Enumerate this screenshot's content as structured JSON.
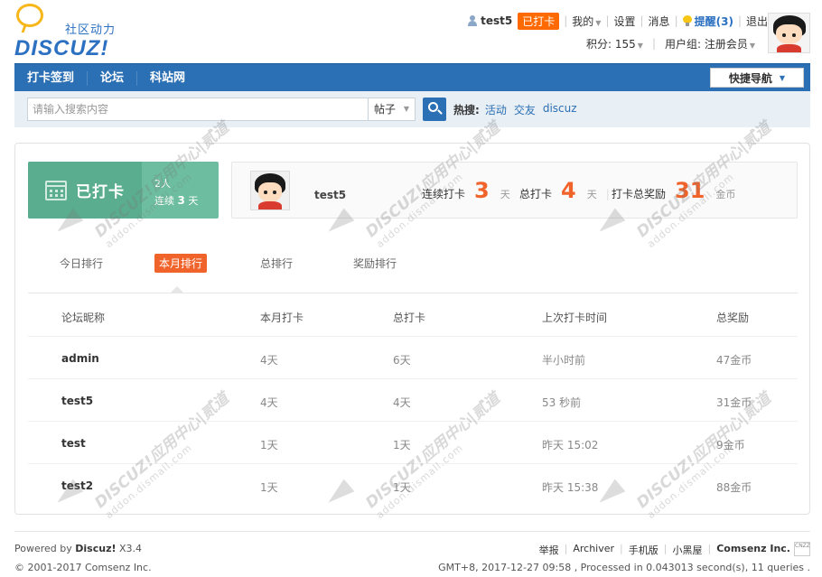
{
  "header": {
    "logo_cn": "社区动力",
    "logo_en": "DISCUZ!",
    "username": "test5",
    "checked_tag": "已打卡",
    "mine": "我的",
    "settings": "设置",
    "messages": "消息",
    "remind": "提醒(3)",
    "logout": "退出",
    "points": "积分: 155",
    "usergroup": "用户组: 注册会员"
  },
  "nav": {
    "items": [
      "打卡签到",
      "论坛",
      "科站网"
    ],
    "quick_nav": "快捷导航"
  },
  "search": {
    "placeholder": "请输入搜索内容",
    "type": "帖子",
    "hot_label": "热搜:",
    "hot_links": [
      "活动",
      "交友",
      "discuz"
    ]
  },
  "sign": {
    "label": "已打卡",
    "count": "2人",
    "streak_prefix": "连续",
    "streak_num": "3",
    "streak_suffix": "天",
    "username": "test5",
    "stats": [
      {
        "label": "连续打卡",
        "value": "3",
        "unit": "天"
      },
      {
        "label": "总打卡",
        "value": "4",
        "unit": "天"
      },
      {
        "label": "打卡总奖励",
        "value": "31",
        "unit": "金币"
      }
    ]
  },
  "tabs": [
    "今日排行",
    "本月排行",
    "总排行",
    "奖励排行"
  ],
  "table": {
    "headers": [
      "论坛昵称",
      "本月打卡",
      "总打卡",
      "上次打卡时间",
      "总奖励"
    ],
    "rows": [
      [
        "admin",
        "4天",
        "6天",
        "半小时前",
        "47金币"
      ],
      [
        "test5",
        "4天",
        "4天",
        "53 秒前",
        "31金币"
      ],
      [
        "test",
        "1天",
        "1天",
        "昨天 15:02",
        "9金币"
      ],
      [
        "test2",
        "1天",
        "1天",
        "昨天 15:38",
        "88金币"
      ]
    ]
  },
  "footer": {
    "powered_prefix": "Powered by",
    "powered_brand": "Discuz!",
    "powered_version": "X3.4",
    "copyright": "© 2001-2017 Comsenz Inc.",
    "links": [
      "举报",
      "Archiver",
      "手机版",
      "小黑屋"
    ],
    "company": "Comsenz Inc.",
    "cnzz": "CNZZ",
    "stats": "GMT+8, 2017-12-27 09:58 , Processed in 0.043013 second(s), 11 queries ."
  },
  "watermark": {
    "line1": "DISCUZ!应用中心|贰道",
    "line2": "addon.dismall.com"
  }
}
